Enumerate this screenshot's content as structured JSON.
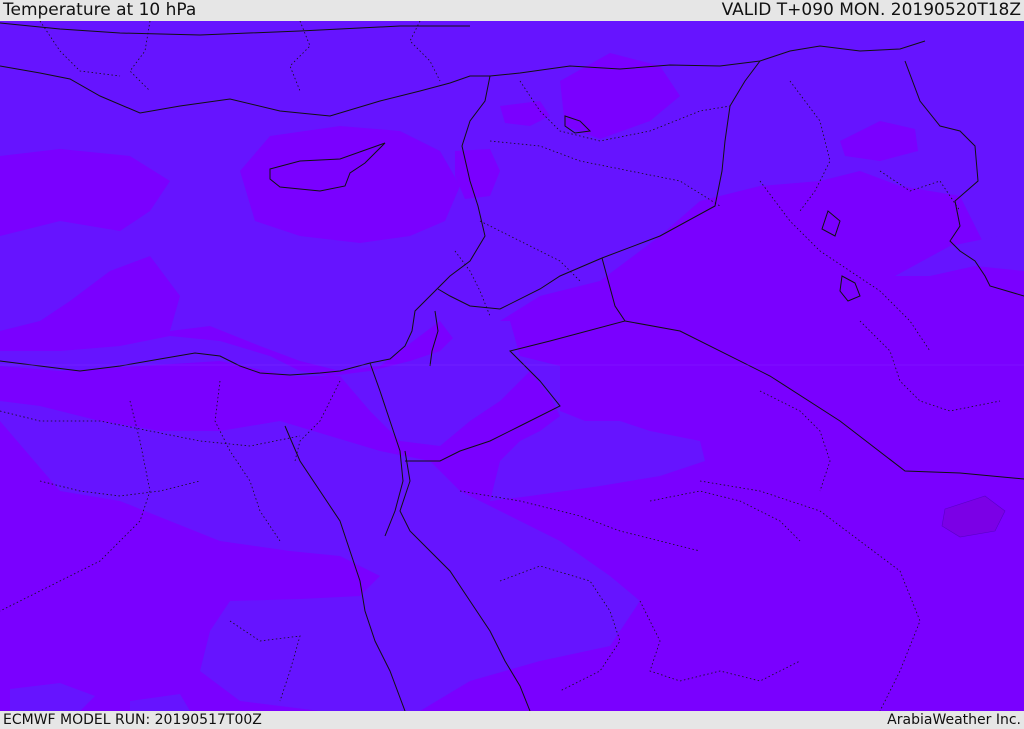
{
  "header": {
    "title": "Temperature at 10 hPa",
    "valid": "VALID T+090 MON. 20190520T18Z"
  },
  "footer": {
    "model_run": "ECMWF MODEL RUN: 20190517T00Z",
    "credit": "ArabiaWeather Inc."
  },
  "map": {
    "colors": {
      "band_violet": "#7a00ff",
      "band_blue": "#6614ff",
      "band_deep": "#7b00e6",
      "border_line": "#111111"
    }
  }
}
